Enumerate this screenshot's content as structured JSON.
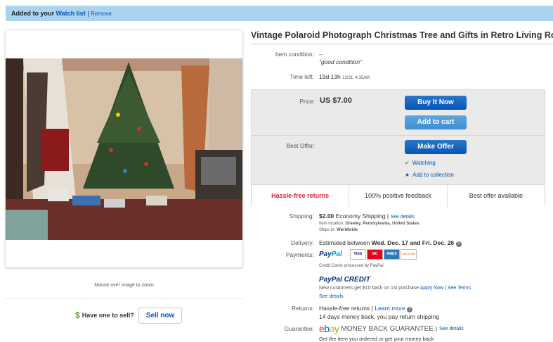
{
  "watchbar": {
    "added": "Added to your",
    "watch_list": "Watch list",
    "remove": "Remove"
  },
  "image": {
    "zoom_hint": "Mouse over image to zoom"
  },
  "sell": {
    "dollar": "$",
    "question": "Have one to sell?",
    "button": "Sell now"
  },
  "title": "Vintage Polaroid Photograph Christmas Tree and Gifts in Retro Living Room",
  "details": {
    "condition_label": "Item condition:",
    "condition_value": "--",
    "condition_quote": "“good condition”",
    "time_left_label": "Time left:",
    "time_left_value": "19d 13h",
    "time_left_date": "12/31, 4:35AM"
  },
  "price": {
    "label": "Price:",
    "value": "US $7.00",
    "buy_now": "Buy It Now",
    "add_cart": "Add to cart",
    "best_offer_label": "Best Offer:",
    "make_offer": "Make Offer",
    "watching": "Watching",
    "add_collection": "Add to collection"
  },
  "features": [
    "Hassle-free returns",
    "100% positive feedback",
    "Best offer available"
  ],
  "shipping": {
    "label": "Shipping:",
    "cost": "$2.00",
    "method": "Economy Shipping",
    "see_details": "See details",
    "location": "Item location:",
    "location_value": "Greeley, Pennsylvania, United States",
    "ships_to": "Ships to:",
    "ships_to_value": "Worldwide"
  },
  "delivery": {
    "label": "Delivery:",
    "text": "Estimated between",
    "dates": "Wed. Dec. 17 and Fri. Dec. 26"
  },
  "payments": {
    "label": "Payments:",
    "paypal_a": "Pay",
    "paypal_b": "Pal",
    "cards": [
      "VISA",
      "MC",
      "AMEX",
      "DISCOVER"
    ],
    "processed": "Credit Cards processed by PayPal",
    "credit": "PayPal CREDIT",
    "credit_offer": "New customers get $10 back on 1st purchase",
    "apply": "Apply Now",
    "see_terms": "See Terms",
    "see_details": "See details"
  },
  "returns": {
    "label": "Returns:",
    "value": "Hassle-free returns",
    "learn_more": "Learn more",
    "policy": "14 days money back, you pay return shipping"
  },
  "guarantee": {
    "label": "Guarantee:",
    "mbg": "MONEY BACK GUARANTEE",
    "see_details": "See details",
    "tagline": "Get the item you ordered or get your money back"
  },
  "colors": {
    "accent": "#0654ba",
    "watchbar": "#a9d3ee",
    "red": "#dd1e31"
  }
}
